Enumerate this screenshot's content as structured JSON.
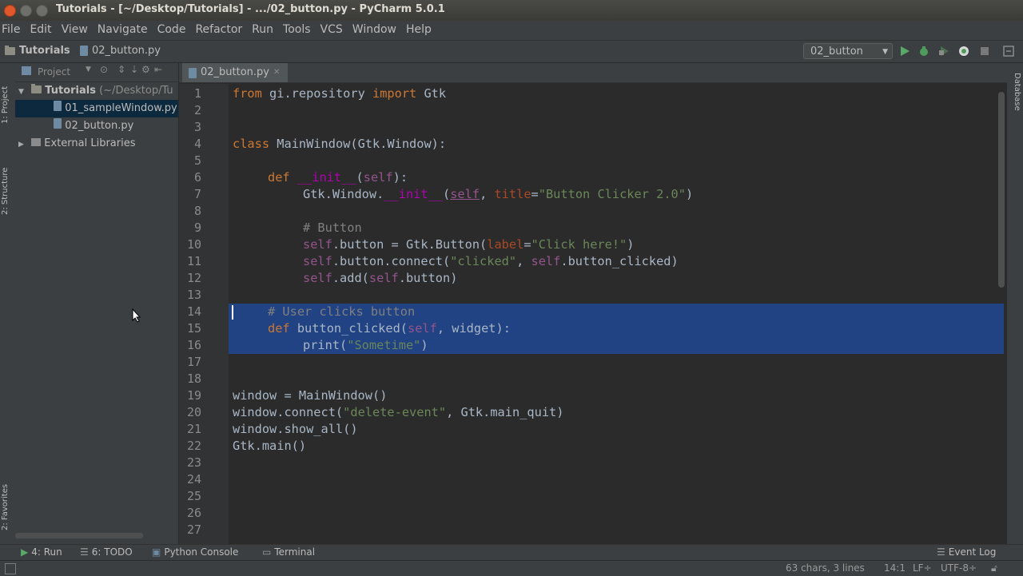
{
  "window": {
    "title": "Tutorials - [~/Desktop/Tutorials] - .../02_button.py - PyCharm 5.0.1"
  },
  "menu": [
    "File",
    "Edit",
    "View",
    "Navigate",
    "Code",
    "Refactor",
    "Run",
    "Tools",
    "VCS",
    "Window",
    "Help"
  ],
  "breadcrumb": {
    "project": "Tutorials",
    "file": "02_button.py"
  },
  "run_config": {
    "label": "02_button"
  },
  "project_panel": {
    "title": "Project",
    "root": "Tutorials",
    "root_path": "(~/Desktop/Tu",
    "files": [
      "01_sampleWindow.py",
      "02_button.py"
    ],
    "external": "External Libraries"
  },
  "left_tabs": [
    "1: Project",
    "2: Structure",
    "2: Favorites"
  ],
  "right_tabs": [
    "Database"
  ],
  "editor": {
    "tab": "02_button.py"
  },
  "line_numbers": [
    "1",
    "2",
    "3",
    "4",
    "5",
    "6",
    "7",
    "8",
    "9",
    "10",
    "11",
    "12",
    "13",
    "14",
    "15",
    "16",
    "17",
    "18",
    "19",
    "20",
    "21",
    "22",
    "23",
    "24",
    "25",
    "26",
    "27"
  ],
  "code": {
    "l1a": "from",
    "l1b": " gi.repository ",
    "l1c": "import",
    "l1d": " Gtk",
    "l4a": "class",
    "l4b": " MainWindow(Gtk.Window):",
    "l6a": "def",
    "l6b": "__init__",
    "l6c": "(",
    "l6d": "self",
    "l6e": "):",
    "l7a": "Gtk.Window.",
    "l7b": "__init__",
    "l7c": "(",
    "l7d": "self",
    "l7e": ", ",
    "l7f": "title",
    "l7g": "=",
    "l7h": "\"Button Clicker 2.0\"",
    "l7i": ")",
    "l9": "# Button",
    "l10a": "self",
    "l10b": ".button = Gtk.Button(",
    "l10c": "label",
    "l10d": "=",
    "l10e": "\"Click here!\"",
    "l10f": ")",
    "l11a": "self",
    "l11b": ".button.connect(",
    "l11c": "\"clicked\"",
    "l11d": ", ",
    "l11e": "self",
    "l11f": ".button_clicked)",
    "l12a": "self",
    "l12b": ".add(",
    "l12c": "self",
    "l12d": ".button)",
    "l14": "# User clicks button",
    "l15a": "def",
    "l15b": " button_clicked(",
    "l15c": "self",
    "l15d": ", widget):",
    "l16a": "print(",
    "l16b": "\"Sometime\"",
    "l16c": ")",
    "l19": "window = MainWindow()",
    "l20a": "window.connect(",
    "l20b": "\"delete-event\"",
    "l20c": ", Gtk.main_quit)",
    "l21": "window.show_all()",
    "l22": "Gtk.main()"
  },
  "bottom_tools": {
    "run": "4: Run",
    "todo": "6: TODO",
    "console": "Python Console",
    "terminal": "Terminal",
    "event_log": "Event Log"
  },
  "status": {
    "chars": "63 chars, 3 lines",
    "position": "14:1",
    "line_sep": "LF÷",
    "encoding": "UTF-8÷"
  },
  "colors": {
    "keyword": "#cc7832",
    "string": "#6a8759",
    "comment": "#808080",
    "selection": "#214283"
  }
}
